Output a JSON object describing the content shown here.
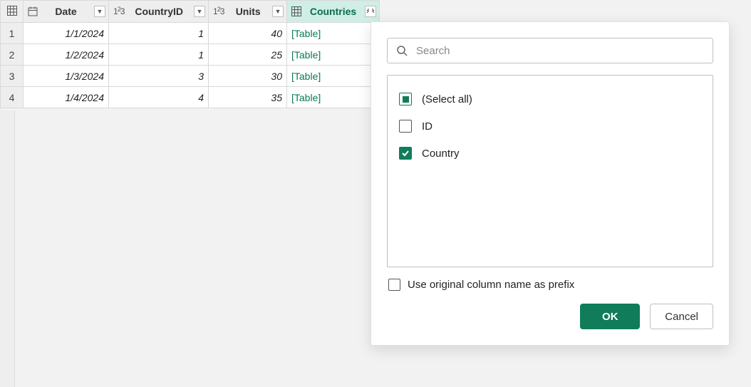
{
  "columns": {
    "date_label": "Date",
    "countryid_label": "CountryID",
    "units_label": "Units",
    "countries_label": "Countries"
  },
  "rows": [
    {
      "n": "1",
      "date": "1/1/2024",
      "countryid": "1",
      "units": "40",
      "countries": "[Table]"
    },
    {
      "n": "2",
      "date": "1/2/2024",
      "countryid": "1",
      "units": "25",
      "countries": "[Table]"
    },
    {
      "n": "3",
      "date": "1/3/2024",
      "countryid": "3",
      "units": "30",
      "countries": "[Table]"
    },
    {
      "n": "4",
      "date": "1/4/2024",
      "countryid": "4",
      "units": "35",
      "countries": "[Table]"
    }
  ],
  "popup": {
    "search_placeholder": "Search",
    "select_all": "(Select all)",
    "opt_id": "ID",
    "opt_country": "Country",
    "prefix_label": "Use original column name as prefix",
    "ok": "OK",
    "cancel": "Cancel"
  }
}
